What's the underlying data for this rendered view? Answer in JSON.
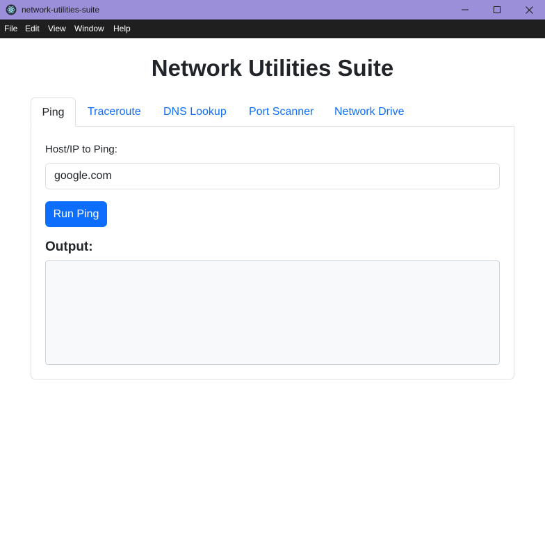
{
  "window": {
    "title": "network-utilities-suite",
    "app_icon": "electron-icon",
    "controls": [
      "minimize-icon",
      "maximize-icon",
      "close-icon"
    ]
  },
  "menu": {
    "items": [
      "File",
      "Edit",
      "View",
      "Window",
      "Help"
    ]
  },
  "page": {
    "title": "Network Utilities Suite"
  },
  "tabs": [
    {
      "label": "Ping",
      "active": true
    },
    {
      "label": "Traceroute",
      "active": false
    },
    {
      "label": "DNS Lookup",
      "active": false
    },
    {
      "label": "Port Scanner",
      "active": false
    },
    {
      "label": "Network Drive",
      "active": false
    }
  ],
  "ping": {
    "host_label": "Host/IP to Ping:",
    "host_value": "google.com",
    "run_label": "Run Ping",
    "output_heading": "Output:",
    "output_text": ""
  },
  "colors": {
    "titlebar": "#9b8fd9",
    "menubar": "#1f1f1f",
    "accent": "#0d6efd",
    "output_background": "#f8f9fa"
  }
}
